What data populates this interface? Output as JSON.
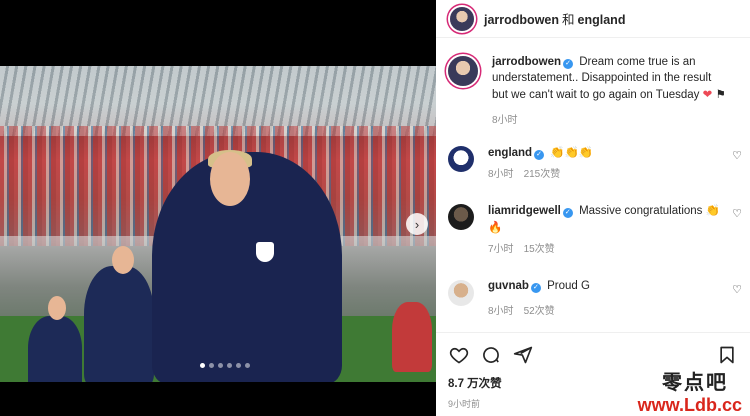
{
  "header": {
    "username": "jarrodbowen",
    "separator": "和",
    "collaborator": "england"
  },
  "comments": [
    {
      "username": "jarrodbowen",
      "verified": true,
      "text": "Dream come true is an understatement.. Disappointed in the result but we can't wait to go again on Tuesday",
      "emojis": "❤ ⚑",
      "time": "8小时",
      "likes": "",
      "reply": ""
    },
    {
      "username": "england",
      "verified": true,
      "text": "",
      "emojis": "👏👏👏",
      "time": "8小时",
      "likes": "215次赞",
      "reply": ""
    },
    {
      "username": "liamridgewell",
      "verified": true,
      "text": "Massive congratulations",
      "emojis": "👏 🔥",
      "time": "7小时",
      "likes": "15次赞",
      "reply": ""
    },
    {
      "username": "guvnab",
      "verified": true,
      "text": "Proud G",
      "emojis": "",
      "time": "8小时",
      "likes": "52次赞",
      "reply": ""
    }
  ],
  "actions": {
    "like_icon": "heart-icon",
    "comment_icon": "comment-icon",
    "share_icon": "send-icon",
    "save_icon": "bookmark-icon"
  },
  "likes_count": "8.7 万次赞",
  "posted_time": "9小时前",
  "carousel": {
    "next_icon": "chevron-right-icon",
    "total_slides": 6,
    "current_slide": 1
  },
  "watermark": {
    "chinese": "零点吧",
    "url": "www.Ldb.cc"
  },
  "colors": {
    "verified": "#3897f0",
    "heart": "#ed4956",
    "meta_gray": "#8e8e8e",
    "watermark_red": "#d9261c"
  }
}
